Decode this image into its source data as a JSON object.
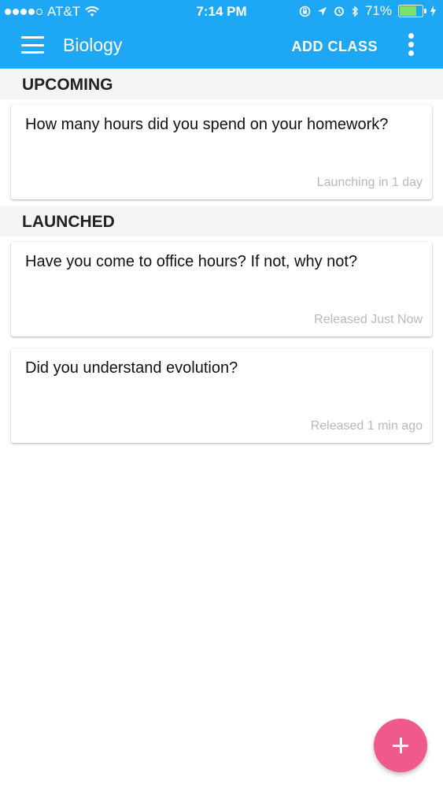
{
  "status_bar": {
    "carrier": "AT&T",
    "time": "7:14 PM",
    "battery_percent": "71%",
    "battery_level": 0.71,
    "colors": {
      "battery_fill": "#7fe06a"
    }
  },
  "app_bar": {
    "title": "Biology",
    "add_class_label": "ADD CLASS",
    "background": "#1ea7f4"
  },
  "sections": [
    {
      "label": "UPCOMING",
      "items": [
        {
          "question": "How many hours did you spend on your homework?",
          "meta": "Launching in 1 day"
        }
      ]
    },
    {
      "label": "LAUNCHED",
      "items": [
        {
          "question": "Have you come to office hours? If not, why not?",
          "meta": "Released Just Now"
        },
        {
          "question": "Did you understand evolution?",
          "meta": "Released 1 min ago"
        }
      ]
    }
  ],
  "fab": {
    "icon": "plus-icon",
    "color": "#ef5a8a"
  }
}
